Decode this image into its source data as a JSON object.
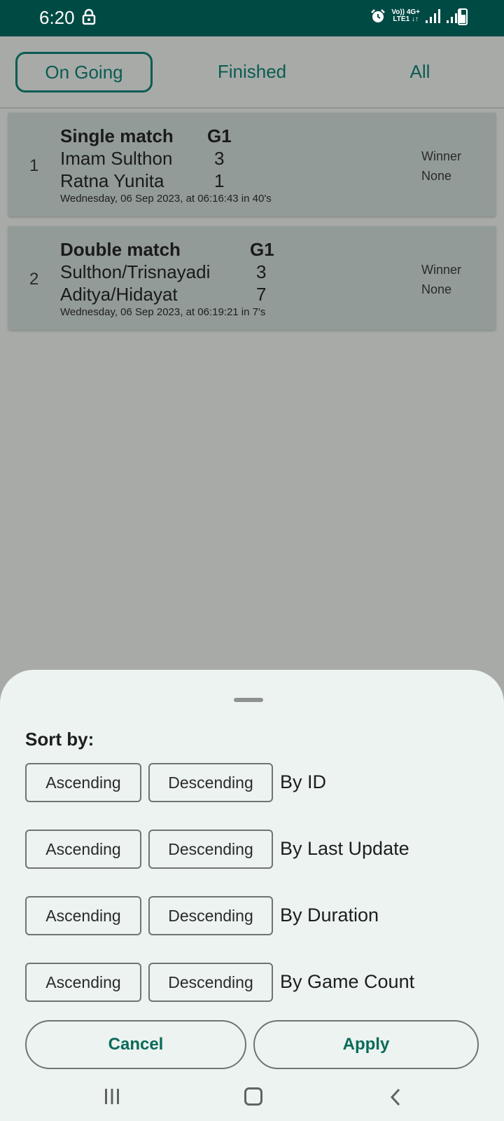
{
  "status_bar": {
    "time": "6:20",
    "net_top": "Vo)) 4G+",
    "net_bottom": "LTE1 ↓↑"
  },
  "tabs": [
    {
      "label": "On Going",
      "active": true
    },
    {
      "label": "Finished",
      "active": false
    },
    {
      "label": "All",
      "active": false
    }
  ],
  "matches": [
    {
      "index": "1",
      "type": "Single match",
      "game": "G1",
      "player1": "Imam Sulthon",
      "score1": "3",
      "player2": "Ratna Yunita",
      "score2": "1",
      "date": "Wednesday, 06 Sep 2023, at 06:16:43 in 40's",
      "winner_label": "Winner",
      "winner": "None"
    },
    {
      "index": "2",
      "type": "Double match",
      "game": "G1",
      "player1": "Sulthon/Trisnayadi",
      "score1": "3",
      "player2": "Aditya/Hidayat",
      "score2": "7",
      "date": "Wednesday, 06 Sep 2023, at 06:19:21 in 7's",
      "winner_label": "Winner",
      "winner": "None"
    }
  ],
  "sort_sheet": {
    "title": "Sort by:",
    "ascending_label": "Ascending",
    "descending_label": "Descending",
    "rows": [
      {
        "label": "By ID"
      },
      {
        "label": "By Last Update"
      },
      {
        "label": "By Duration"
      },
      {
        "label": "By Game Count"
      }
    ],
    "cancel_label": "Cancel",
    "apply_label": "Apply"
  },
  "colors": {
    "status_bar": "#004a44",
    "accent": "#0a5c52",
    "sheet": "#ecf3f0",
    "scrim": "#a8aaa8",
    "card": "#929b98"
  }
}
